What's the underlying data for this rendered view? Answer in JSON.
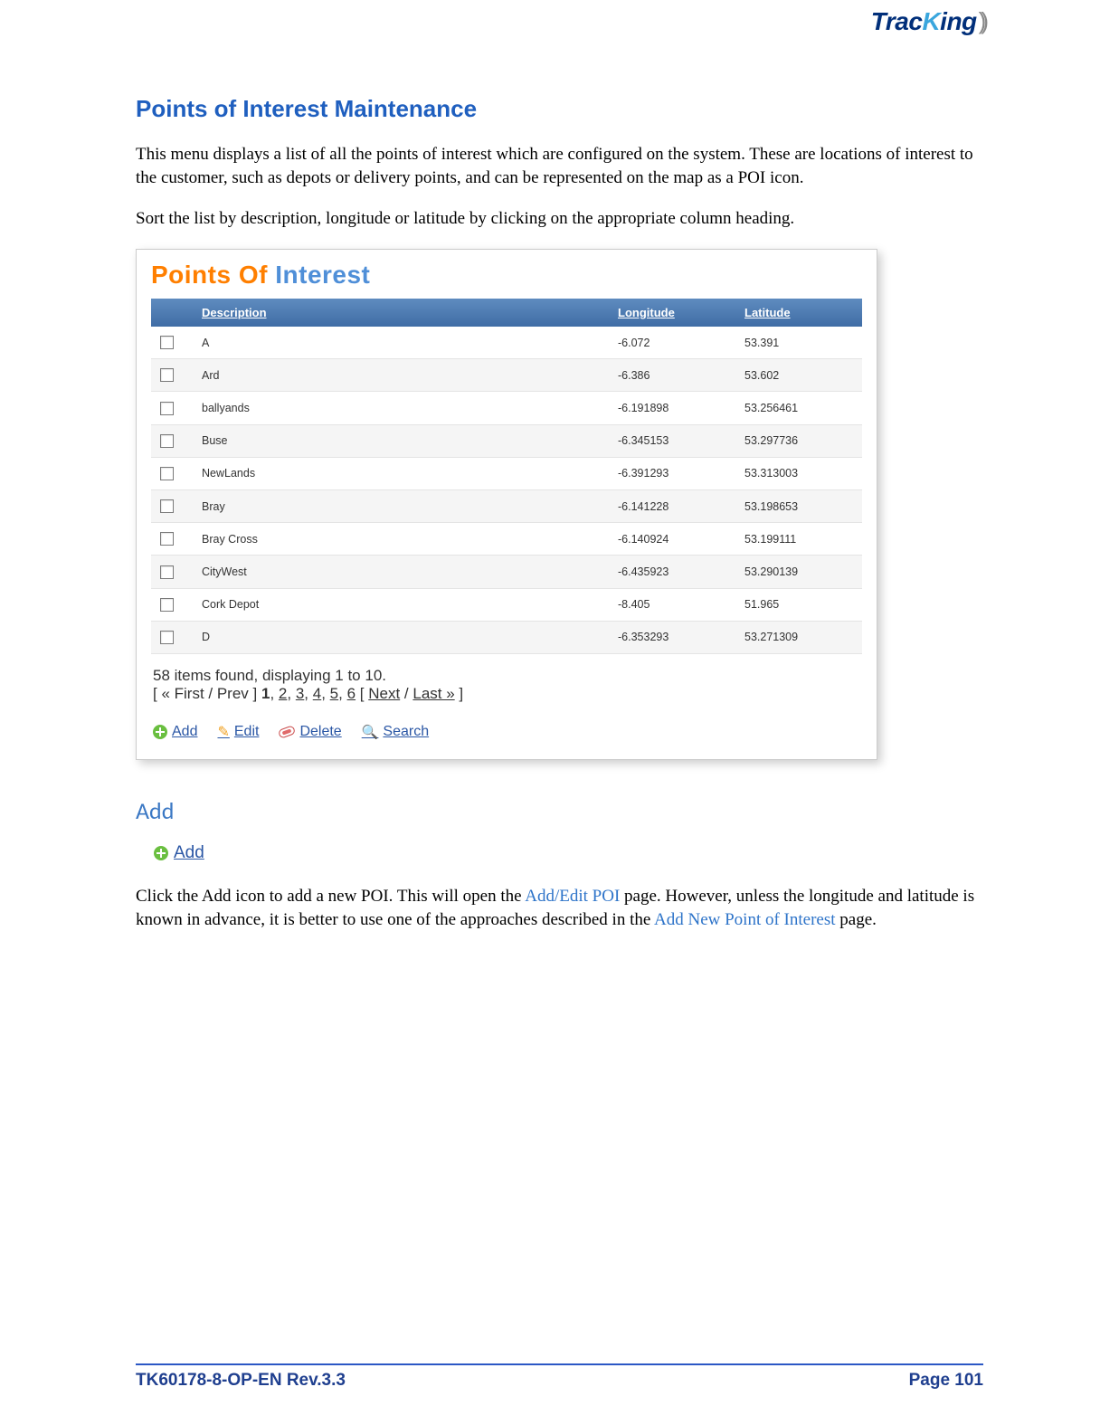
{
  "logo": {
    "part1": "Trac",
    "part2": "K",
    "part3": "ing"
  },
  "heading": "Points of Interest Maintenance",
  "intro1": "This menu displays a list of all the points of interest which are configured on the system. These are locations of interest to the customer, such as depots or delivery points, and can be represented on the map as a POI icon.",
  "intro2": "Sort the list by description, longitude or latitude by clicking on the appropriate column heading.",
  "panel": {
    "title_a": "Points Of ",
    "title_b": "Interest",
    "headers": {
      "desc": "Description",
      "lon": "Longitude",
      "lat": "Latitude"
    },
    "rows": [
      {
        "desc": "A",
        "lon": "-6.072",
        "lat": "53.391"
      },
      {
        "desc": "Ard",
        "lon": "-6.386",
        "lat": "53.602"
      },
      {
        "desc": "ballyands",
        "lon": "-6.191898",
        "lat": "53.256461"
      },
      {
        "desc": "Buse",
        "lon": "-6.345153",
        "lat": "53.297736"
      },
      {
        "desc": "NewLands",
        "lon": "-6.391293",
        "lat": "53.313003"
      },
      {
        "desc": "Bray",
        "lon": "-6.141228",
        "lat": "53.198653"
      },
      {
        "desc": "Bray Cross",
        "lon": "-6.140924",
        "lat": "53.199111"
      },
      {
        "desc": "CityWest",
        "lon": "-6.435923",
        "lat": "53.290139"
      },
      {
        "desc": "Cork Depot",
        "lon": "-8.405",
        "lat": "51.965"
      },
      {
        "desc": "D",
        "lon": "-6.353293",
        "lat": "53.271309"
      }
    ],
    "pager_summary": "58 items found, displaying 1 to 10.",
    "pager": {
      "open": "[ ",
      "first_prev": "« First / Prev ] ",
      "current": "1",
      "p2": "2",
      "p3": "3",
      "p4": "4",
      "p5": "5",
      "p6": "6",
      "next": "Next",
      "last": "Last »",
      "close": " ]"
    },
    "actions": {
      "add": "Add",
      "edit": "Edit",
      "delete": "Delete",
      "search": "Search"
    }
  },
  "sub_heading": "Add",
  "add_chip": "Add",
  "para_add": {
    "t1": "Click the Add icon to add a new POI. This will open the ",
    "l1": "Add/Edit POI",
    "t2": " page. However, unless the longitude and latitude is known in advance, it is better to use one of the approaches described in the ",
    "l2": "Add New Point of Interest",
    "t3": " page."
  },
  "footer": {
    "left": "TK60178-8-OP-EN Rev.3.3",
    "right": "Page  101"
  }
}
